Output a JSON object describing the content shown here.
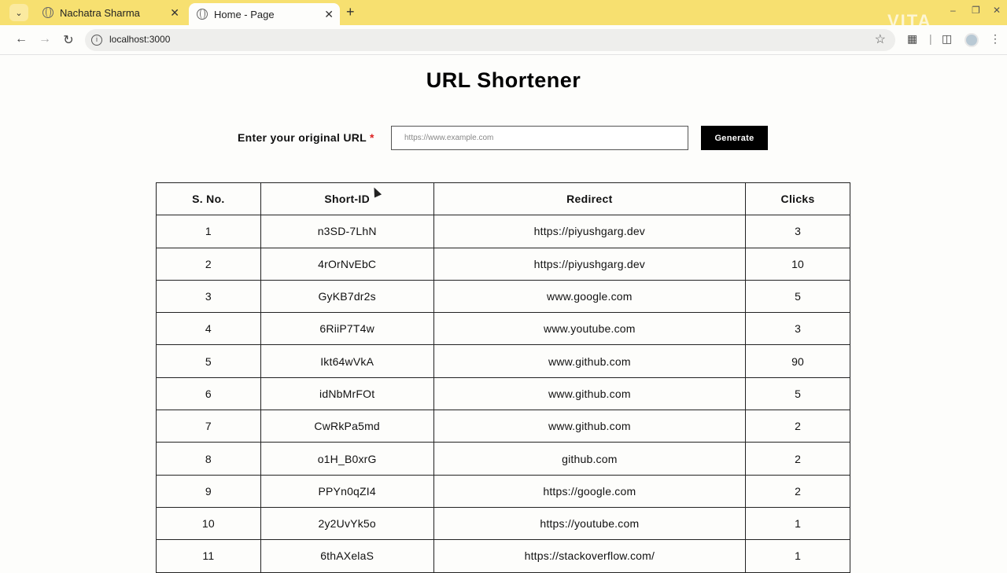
{
  "browser": {
    "tabs": [
      {
        "title": "Nachatra Sharma",
        "active": false
      },
      {
        "title": "Home - Page",
        "active": true
      }
    ],
    "address": "localhost:3000",
    "accent": "#f7e070"
  },
  "page": {
    "title": "URL Shortener",
    "form": {
      "label": "Enter your original URL",
      "required_mark": "*",
      "placeholder": "https://www.example.com",
      "value": "",
      "button_label": "Generate"
    },
    "table": {
      "headers": [
        "S. No.",
        "Short-ID",
        "Redirect",
        "Clicks"
      ],
      "rows": [
        [
          "1",
          "n3SD-7LhN",
          "https://piyushgarg.dev",
          "3"
        ],
        [
          "2",
          "4rOrNvEbC",
          "https://piyushgarg.dev",
          "10"
        ],
        [
          "3",
          "GyKB7dr2s",
          "www.google.com",
          "5"
        ],
        [
          "4",
          "6RiiP7T4w",
          "www.youtube.com",
          "3"
        ],
        [
          "5",
          "Ikt64wVkA",
          "www.github.com",
          "90"
        ],
        [
          "6",
          "idNbMrFOt",
          "www.github.com",
          "5"
        ],
        [
          "7",
          "CwRkPa5md",
          "www.github.com",
          "2"
        ],
        [
          "8",
          "o1H_B0xrG",
          "github.com",
          "2"
        ],
        [
          "9",
          "PPYn0qZI4",
          "https://google.com",
          "2"
        ],
        [
          "10",
          "2y2UvYk5o",
          "https://youtube.com",
          "1"
        ],
        [
          "11",
          "6thAXelaS",
          "https://stackoverflow.com/",
          "1"
        ]
      ]
    }
  }
}
